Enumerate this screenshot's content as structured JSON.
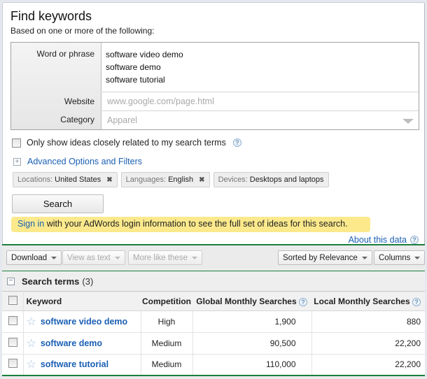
{
  "header": {
    "title": "Find keywords",
    "subtitle": "Based on one or more of the following:"
  },
  "form": {
    "word_label": "Word or phrase",
    "phrases": [
      "software video demo",
      "software demo",
      "software tutorial"
    ],
    "website_label": "Website",
    "website_placeholder": "www.google.com/page.html",
    "category_label": "Category",
    "category_placeholder": "Apparel"
  },
  "options": {
    "closely_related_label": "Only show ideas closely related to my search terms",
    "closely_related_checked": false,
    "advanced_label": "Advanced Options and Filters"
  },
  "chips": [
    {
      "key": "Locations:",
      "value": "United States",
      "removable": true
    },
    {
      "key": "Languages:",
      "value": "English",
      "removable": true
    },
    {
      "key": "Devices:",
      "value": "Desktops and laptops",
      "removable": false
    }
  ],
  "search_button": "Search",
  "notice": {
    "link": "Sign in",
    "text": " with your AdWords login information to see the full set of ideas for this search."
  },
  "about_link": "About this data",
  "toolbar": {
    "download": "Download",
    "view_as_text": "View as text",
    "more_like_these": "More like these",
    "sort": "Sorted by Relevance",
    "columns": "Columns"
  },
  "group": {
    "title": "Search terms",
    "count": "(3)"
  },
  "table": {
    "headers": [
      "Keyword",
      "Competition",
      "Global Monthly Searches",
      "Local Monthly Searches"
    ],
    "rows": [
      {
        "keyword": "software video demo",
        "competition": "High",
        "global": "1,900",
        "local": "880"
      },
      {
        "keyword": "software demo",
        "competition": "Medium",
        "global": "90,500",
        "local": "22,200"
      },
      {
        "keyword": "software tutorial",
        "competition": "Medium",
        "global": "110,000",
        "local": "22,200"
      }
    ]
  },
  "icons": {
    "help": "?",
    "plus": "+",
    "minus": "−",
    "remove": "✖",
    "star": "☆"
  }
}
